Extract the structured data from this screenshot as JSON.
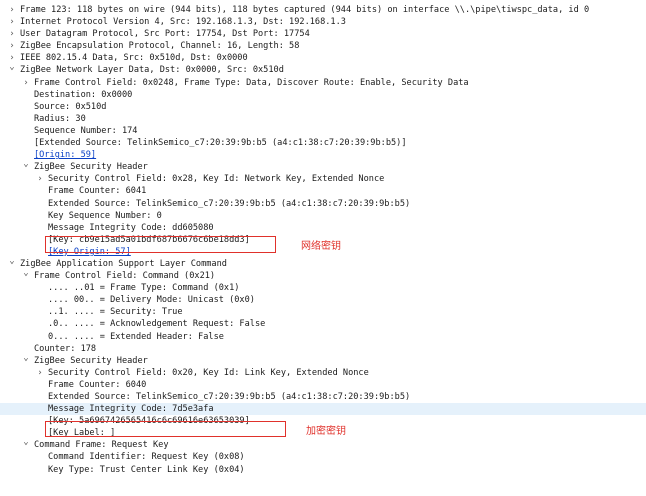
{
  "tree": [
    {
      "level": 0,
      "toggle": "collapsed",
      "text": "Frame 123: 118 bytes on wire (944 bits), 118 bytes captured (944 bits) on interface \\\\.\\pipe\\tiwspc_data, id 0"
    },
    {
      "level": 0,
      "toggle": "collapsed",
      "text": "Internet Protocol Version 4, Src: 192.168.1.3, Dst: 192.168.1.3"
    },
    {
      "level": 0,
      "toggle": "collapsed",
      "text": "User Datagram Protocol, Src Port: 17754, Dst Port: 17754"
    },
    {
      "level": 0,
      "toggle": "collapsed",
      "text": "ZigBee Encapsulation Protocol, Channel: 16, Length: 58"
    },
    {
      "level": 0,
      "toggle": "collapsed",
      "text": "IEEE 802.15.4 Data, Src: 0x510d, Dst: 0x0000"
    },
    {
      "level": 0,
      "toggle": "expanded",
      "text": "ZigBee Network Layer Data, Dst: 0x0000, Src: 0x510d"
    },
    {
      "level": 1,
      "toggle": "collapsed",
      "text": "Frame Control Field: 0x0248, Frame Type: Data, Discover Route: Enable, Security Data"
    },
    {
      "level": 1,
      "toggle": "none",
      "text": "Destination: 0x0000"
    },
    {
      "level": 1,
      "toggle": "none",
      "text": "Source: 0x510d"
    },
    {
      "level": 1,
      "toggle": "none",
      "text": "Radius: 30"
    },
    {
      "level": 1,
      "toggle": "none",
      "text": "Sequence Number: 174"
    },
    {
      "level": 1,
      "toggle": "none",
      "text": "[Extended Source: TelinkSemico_c7:20:39:9b:b5 (a4:c1:38:c7:20:39:9b:b5)]"
    },
    {
      "level": 1,
      "toggle": "none",
      "text": "[Origin: 59]",
      "link": true
    },
    {
      "level": 1,
      "toggle": "expanded",
      "text": "ZigBee Security Header"
    },
    {
      "level": 2,
      "toggle": "collapsed",
      "text": "Security Control Field: 0x28, Key Id: Network Key, Extended Nonce"
    },
    {
      "level": 2,
      "toggle": "none",
      "text": "Frame Counter: 6041"
    },
    {
      "level": 2,
      "toggle": "none",
      "text": "Extended Source: TelinkSemico_c7:20:39:9b:b5 (a4:c1:38:c7:20:39:9b:b5)"
    },
    {
      "level": 2,
      "toggle": "none",
      "text": "Key Sequence Number: 0"
    },
    {
      "level": 2,
      "toggle": "none",
      "text": "Message Integrity Code: dd605080"
    },
    {
      "level": 2,
      "toggle": "none",
      "text": "[Key: cb9e15ad5a01bdf687b6676c6be18dd3]",
      "boxed": true
    },
    {
      "level": 2,
      "toggle": "none",
      "text": "[Key Origin: 57]",
      "link": true
    },
    {
      "level": 0,
      "toggle": "expanded",
      "text": "ZigBee Application Support Layer Command"
    },
    {
      "level": 1,
      "toggle": "expanded",
      "text": "Frame Control Field: Command (0x21)"
    },
    {
      "level": 2,
      "toggle": "none",
      "text": ".... ..01 = Frame Type: Command (0x1)"
    },
    {
      "level": 2,
      "toggle": "none",
      "text": ".... 00.. = Delivery Mode: Unicast (0x0)"
    },
    {
      "level": 2,
      "toggle": "none",
      "text": "..1. .... = Security: True"
    },
    {
      "level": 2,
      "toggle": "none",
      "text": ".0.. .... = Acknowledgement Request: False"
    },
    {
      "level": 2,
      "toggle": "none",
      "text": "0... .... = Extended Header: False"
    },
    {
      "level": 1,
      "toggle": "none",
      "text": "Counter: 178"
    },
    {
      "level": 1,
      "toggle": "expanded",
      "text": "ZigBee Security Header"
    },
    {
      "level": 2,
      "toggle": "collapsed",
      "text": "Security Control Field: 0x20, Key Id: Link Key, Extended Nonce"
    },
    {
      "level": 2,
      "toggle": "none",
      "text": "Frame Counter: 6040"
    },
    {
      "level": 2,
      "toggle": "none",
      "text": "Extended Source: TelinkSemico_c7:20:39:9b:b5 (a4:c1:38:c7:20:39:9b:b5)"
    },
    {
      "level": 2,
      "toggle": "none",
      "text": "Message Integrity Code: 7d5e3afa",
      "highlight": true
    },
    {
      "level": 2,
      "toggle": "none",
      "text": "[Key: 5a6967426565416c6c69616e63653039]",
      "boxed": true
    },
    {
      "level": 2,
      "toggle": "none",
      "text": "[Key Label: ]"
    },
    {
      "level": 1,
      "toggle": "expanded",
      "text": "Command Frame: Request Key"
    },
    {
      "level": 2,
      "toggle": "none",
      "text": "Command Identifier: Request Key (0x08)"
    },
    {
      "level": 2,
      "toggle": "none",
      "text": "Key Type: Trust Center Link Key (0x04)"
    }
  ],
  "annotations": {
    "network_key": "网络密钥",
    "link_key": "加密密钥"
  },
  "colors": {
    "annotation": "#e0312b",
    "link": "#0b41c6",
    "highlight": "#e5f1fb"
  },
  "icons": {
    "collapsed": "chevron-right-icon",
    "expanded": "chevron-down-icon"
  }
}
